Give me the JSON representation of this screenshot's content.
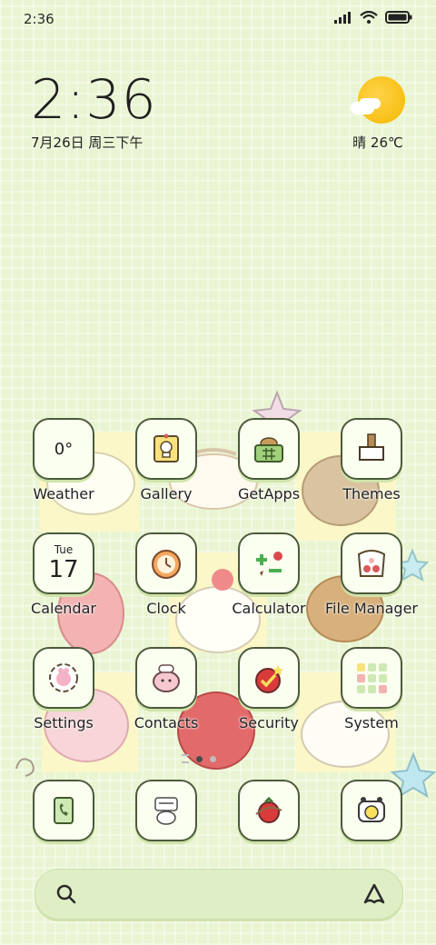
{
  "status_bar": {
    "time": "2:36"
  },
  "clock_widget": {
    "time": "2:36",
    "date": "7月26日 周三下午"
  },
  "weather_widget": {
    "text": "晴 26℃"
  },
  "apps": [
    {
      "label": "Weather",
      "glyph": "0°"
    },
    {
      "label": "Gallery"
    },
    {
      "label": "GetApps"
    },
    {
      "label": "Themes"
    },
    {
      "label": "Calendar",
      "day": "Tue",
      "date": "17"
    },
    {
      "label": "Clock"
    },
    {
      "label": "Calculator"
    },
    {
      "label": "File Manager"
    },
    {
      "label": "Settings"
    },
    {
      "label": "Contacts"
    },
    {
      "label": "Security"
    },
    {
      "label": "System"
    }
  ],
  "dock": [
    {
      "name": "phone"
    },
    {
      "name": "messages"
    },
    {
      "name": "browser"
    },
    {
      "name": "camera"
    }
  ],
  "colors": {
    "background": "#e9f5d2",
    "icon_border": "#4c5a3c",
    "icon_fill": "#fbfff0"
  }
}
